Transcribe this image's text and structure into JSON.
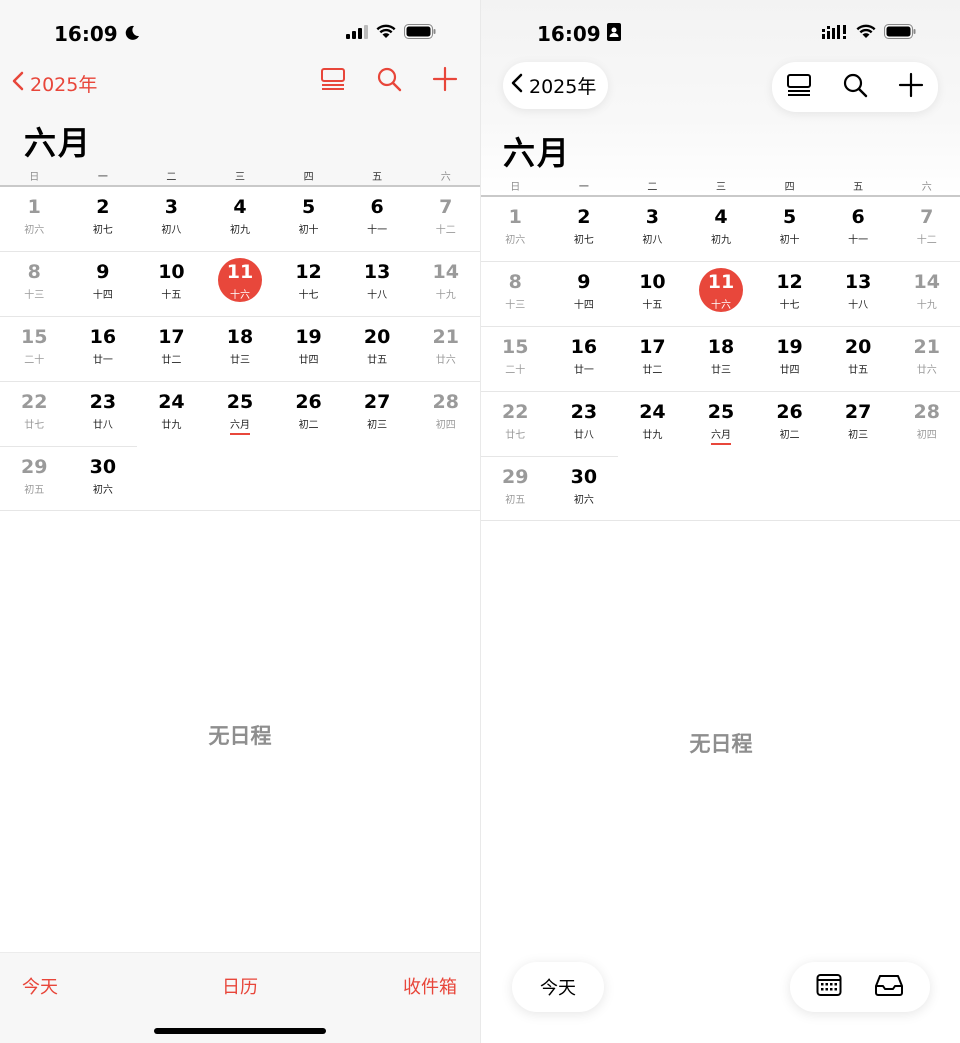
{
  "left": {
    "status": {
      "time": "16:09"
    },
    "nav": {
      "back_label": "2025年"
    },
    "month": "六月",
    "weekdays": [
      "日",
      "一",
      "二",
      "三",
      "四",
      "五",
      "六"
    ],
    "weeks": [
      [
        {
          "d": "1",
          "l": "初六"
        },
        {
          "d": "2",
          "l": "初七"
        },
        {
          "d": "3",
          "l": "初八"
        },
        {
          "d": "4",
          "l": "初九"
        },
        {
          "d": "5",
          "l": "初十"
        },
        {
          "d": "6",
          "l": "十一"
        },
        {
          "d": "7",
          "l": "十二"
        }
      ],
      [
        {
          "d": "8",
          "l": "十三"
        },
        {
          "d": "9",
          "l": "十四"
        },
        {
          "d": "10",
          "l": "十五"
        },
        {
          "d": "11",
          "l": "十六"
        },
        {
          "d": "12",
          "l": "十七"
        },
        {
          "d": "13",
          "l": "十八"
        },
        {
          "d": "14",
          "l": "十九"
        }
      ],
      [
        {
          "d": "15",
          "l": "二十"
        },
        {
          "d": "16",
          "l": "廿一"
        },
        {
          "d": "17",
          "l": "廿二"
        },
        {
          "d": "18",
          "l": "廿三"
        },
        {
          "d": "19",
          "l": "廿四"
        },
        {
          "d": "20",
          "l": "廿五"
        },
        {
          "d": "21",
          "l": "廿六"
        }
      ],
      [
        {
          "d": "22",
          "l": "廿七"
        },
        {
          "d": "23",
          "l": "廿八"
        },
        {
          "d": "24",
          "l": "廿九"
        },
        {
          "d": "25",
          "l": "六月"
        },
        {
          "d": "26",
          "l": "初二"
        },
        {
          "d": "27",
          "l": "初三"
        },
        {
          "d": "28",
          "l": "初四"
        }
      ],
      [
        {
          "d": "29",
          "l": "初五"
        },
        {
          "d": "30",
          "l": "初六"
        }
      ]
    ],
    "no_events": "无日程",
    "toolbar": {
      "today": "今天",
      "calendars": "日历",
      "inbox": "收件箱"
    }
  },
  "right": {
    "status": {
      "time": "16:09"
    },
    "nav": {
      "back_label": "2025年"
    },
    "month": "六月",
    "no_events": "无日程",
    "toolbar": {
      "today": "今天"
    }
  },
  "colors": {
    "accent": "#e8473b",
    "weekend": "#9a9a9a"
  },
  "today_day": "11",
  "marked_day": "25"
}
